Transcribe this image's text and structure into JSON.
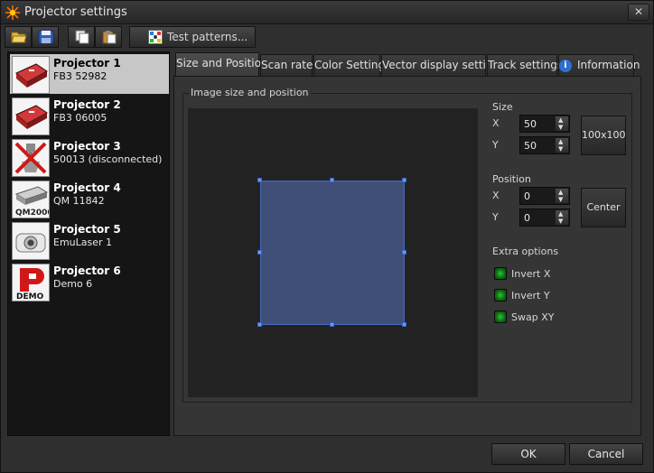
{
  "window": {
    "title": "Projector settings",
    "close_label": "✕"
  },
  "toolbar": {
    "test_patterns_label": "Test patterns..."
  },
  "projectors": [
    {
      "name": "Projector 1",
      "sub": "FB3 52982",
      "icon": "fb3-device-icon",
      "thumb_caption": ""
    },
    {
      "name": "Projector 2",
      "sub": "FB3 06005",
      "icon": "fb3-device-icon",
      "thumb_caption": ""
    },
    {
      "name": "Projector 3",
      "sub": "50013 (disconnected)",
      "icon": "disconnected-device-icon",
      "thumb_caption": ""
    },
    {
      "name": "Projector 4",
      "sub": "QM 11842",
      "icon": "qm2000-device-icon",
      "thumb_caption": "QM2000"
    },
    {
      "name": "Projector 5",
      "sub": "EmuLaser 1",
      "icon": "emulaser-projector-icon",
      "thumb_caption": ""
    },
    {
      "name": "Projector 6",
      "sub": "Demo 6",
      "icon": "demo-device-icon",
      "thumb_caption": "DEMO"
    }
  ],
  "tabs": [
    {
      "label": "Size and Position"
    },
    {
      "label": "Scan rate"
    },
    {
      "label": "Color Settings"
    },
    {
      "label": "Vector display settings"
    },
    {
      "label": "Track settings"
    },
    {
      "label": "Information"
    }
  ],
  "group": {
    "title": "Image size and position"
  },
  "size": {
    "title": "Size",
    "x_label": "X",
    "x_value": "50",
    "y_label": "Y",
    "y_value": "50",
    "preset_label": "100x100"
  },
  "position": {
    "title": "Position",
    "x_label": "X",
    "x_value": "0",
    "y_label": "Y",
    "y_value": "0",
    "center_label": "Center"
  },
  "extra": {
    "title": "Extra options",
    "invert_x": "Invert X",
    "invert_y": "Invert Y",
    "swap_xy": "Swap XY"
  },
  "footer": {
    "ok_label": "OK",
    "cancel_label": "Cancel"
  },
  "colors": {
    "accent": "#4a69ba",
    "rect_fill": "#3f4f78",
    "selected_item": "#c7c7c7",
    "check_green": "#2fc437"
  }
}
